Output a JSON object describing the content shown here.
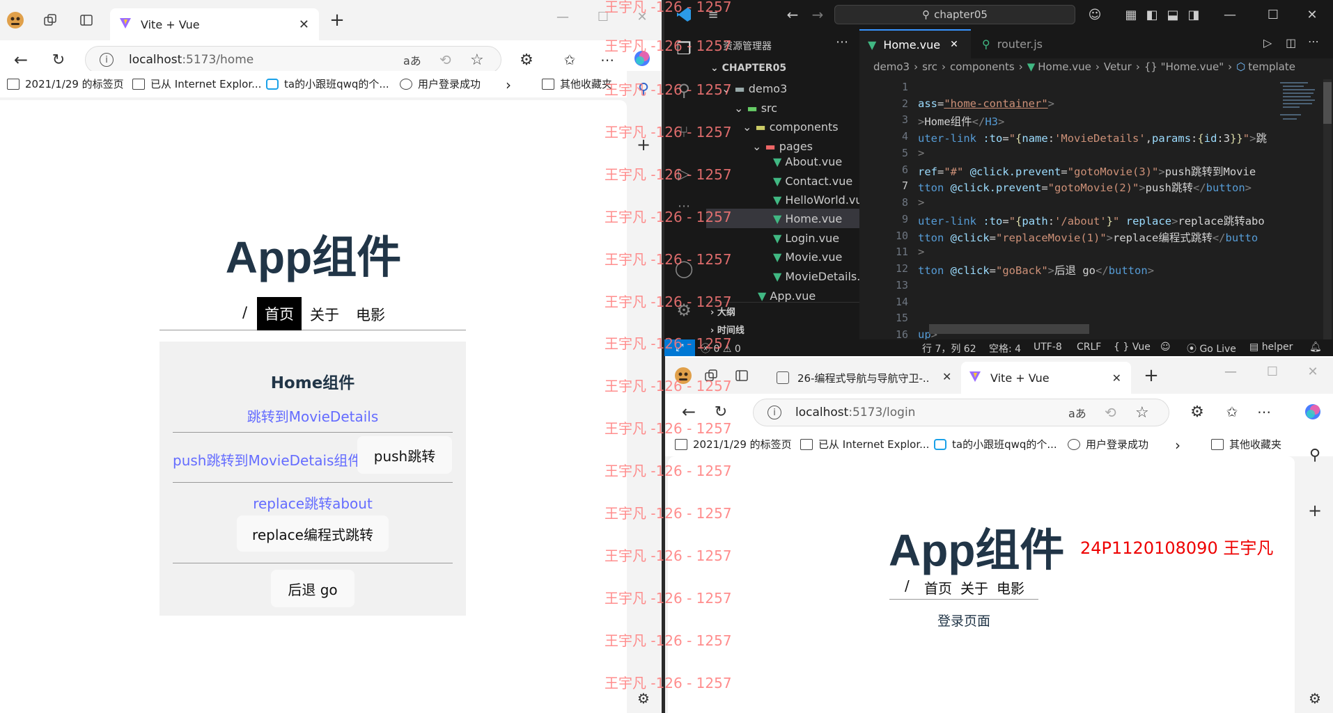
{
  "left_browser": {
    "tab_title": "Vite + Vue",
    "url_host": "localhost",
    "url_rest": ":5173/home",
    "bookmarks": [
      "2021/1/29 的标签页",
      "已从 Internet Explor...",
      "ta的小跟班qwq的个...",
      "用户登录成功",
      "其他收藏夹"
    ],
    "page": {
      "app_title": "App组件",
      "nav_slash": "/",
      "nav_home": "首页",
      "nav_about": "关于",
      "nav_movie": "电影",
      "home_title": "Home组件",
      "link_movie_details": "跳转到MovieDetails",
      "link_push": "push跳转到MovieDetais组件",
      "btn_push": "push跳转",
      "link_replace": "replace跳转about",
      "btn_replace": "replace编程式跳转",
      "btn_back": "后退 go"
    }
  },
  "watermark": "王宇凡 -126 - 1257",
  "vscode": {
    "search_text": "chapter05",
    "explorer_title": "资源管理器",
    "tab_active": "Home.vue",
    "tab_other": "router.js",
    "root": "CHAPTER05",
    "tree": [
      "demo3",
      "src",
      "components",
      "pages",
      "About.vue",
      "Contact.vue",
      "HelloWorld.vue",
      "Home.vue",
      "Login.vue",
      "Movie.vue",
      "MovieDetails.v...",
      "App.vue"
    ],
    "outline": "大纲",
    "timeline": "时间线",
    "breadcrumb": [
      "demo3",
      "src",
      "components",
      "Home.vue",
      "Vetur",
      "{} \"Home.vue\"",
      "template"
    ],
    "line_numbers": [
      "1",
      "2",
      "3",
      "4",
      "5",
      "6",
      "7",
      "8",
      "9",
      "10",
      "11",
      "12",
      "13",
      "14",
      "15",
      "16"
    ],
    "status": {
      "errors": "0",
      "warnings": "0",
      "position": "行 7，列 62",
      "spaces": "空格: 4",
      "encoding": "UTF-8",
      "eol": "CRLF",
      "language": "Vue",
      "golive": "Go Live",
      "helper": "helper"
    }
  },
  "right_browser": {
    "tab1_title": "26-编程式导航与导航守卫-...",
    "tab2_title": "Vite + Vue",
    "url_host": "localhost",
    "url_rest": ":5173/login",
    "bookmarks": [
      "2021/1/29 的标签页",
      "已从 Internet Explor...",
      "ta的小跟班qwq的个...",
      "用户登录成功",
      "其他收藏夹"
    ],
    "page": {
      "app_title": "App组件",
      "student": "24P1120108090 王宇凡",
      "nav_slash": "/",
      "nav_home": "首页",
      "nav_about": "关于",
      "nav_movie": "电影",
      "login_text": "登录页面"
    }
  }
}
